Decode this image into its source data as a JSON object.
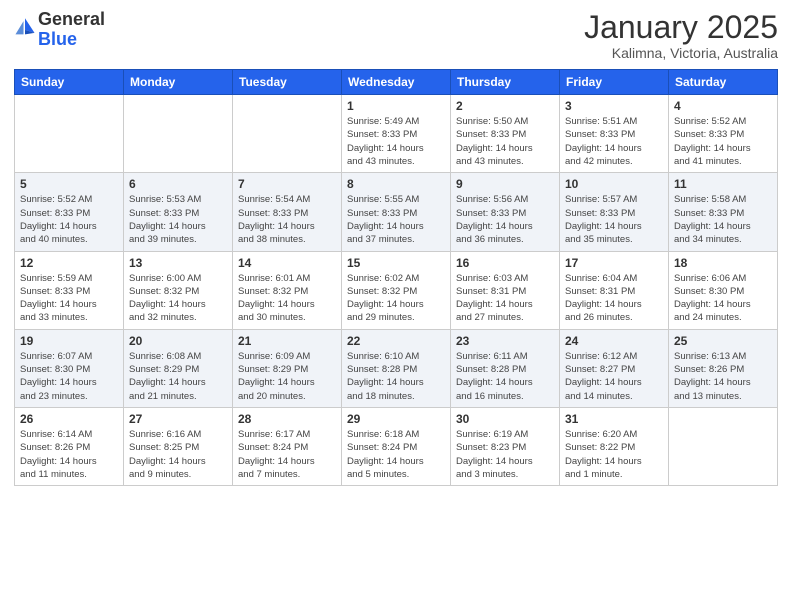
{
  "header": {
    "logo_general": "General",
    "logo_blue": "Blue",
    "month_title": "January 2025",
    "location": "Kalimna, Victoria, Australia"
  },
  "weekdays": [
    "Sunday",
    "Monday",
    "Tuesday",
    "Wednesday",
    "Thursday",
    "Friday",
    "Saturday"
  ],
  "weeks": [
    [
      {
        "num": "",
        "info": ""
      },
      {
        "num": "",
        "info": ""
      },
      {
        "num": "",
        "info": ""
      },
      {
        "num": "1",
        "info": "Sunrise: 5:49 AM\nSunset: 8:33 PM\nDaylight: 14 hours\nand 43 minutes."
      },
      {
        "num": "2",
        "info": "Sunrise: 5:50 AM\nSunset: 8:33 PM\nDaylight: 14 hours\nand 43 minutes."
      },
      {
        "num": "3",
        "info": "Sunrise: 5:51 AM\nSunset: 8:33 PM\nDaylight: 14 hours\nand 42 minutes."
      },
      {
        "num": "4",
        "info": "Sunrise: 5:52 AM\nSunset: 8:33 PM\nDaylight: 14 hours\nand 41 minutes."
      }
    ],
    [
      {
        "num": "5",
        "info": "Sunrise: 5:52 AM\nSunset: 8:33 PM\nDaylight: 14 hours\nand 40 minutes."
      },
      {
        "num": "6",
        "info": "Sunrise: 5:53 AM\nSunset: 8:33 PM\nDaylight: 14 hours\nand 39 minutes."
      },
      {
        "num": "7",
        "info": "Sunrise: 5:54 AM\nSunset: 8:33 PM\nDaylight: 14 hours\nand 38 minutes."
      },
      {
        "num": "8",
        "info": "Sunrise: 5:55 AM\nSunset: 8:33 PM\nDaylight: 14 hours\nand 37 minutes."
      },
      {
        "num": "9",
        "info": "Sunrise: 5:56 AM\nSunset: 8:33 PM\nDaylight: 14 hours\nand 36 minutes."
      },
      {
        "num": "10",
        "info": "Sunrise: 5:57 AM\nSunset: 8:33 PM\nDaylight: 14 hours\nand 35 minutes."
      },
      {
        "num": "11",
        "info": "Sunrise: 5:58 AM\nSunset: 8:33 PM\nDaylight: 14 hours\nand 34 minutes."
      }
    ],
    [
      {
        "num": "12",
        "info": "Sunrise: 5:59 AM\nSunset: 8:33 PM\nDaylight: 14 hours\nand 33 minutes."
      },
      {
        "num": "13",
        "info": "Sunrise: 6:00 AM\nSunset: 8:32 PM\nDaylight: 14 hours\nand 32 minutes."
      },
      {
        "num": "14",
        "info": "Sunrise: 6:01 AM\nSunset: 8:32 PM\nDaylight: 14 hours\nand 30 minutes."
      },
      {
        "num": "15",
        "info": "Sunrise: 6:02 AM\nSunset: 8:32 PM\nDaylight: 14 hours\nand 29 minutes."
      },
      {
        "num": "16",
        "info": "Sunrise: 6:03 AM\nSunset: 8:31 PM\nDaylight: 14 hours\nand 27 minutes."
      },
      {
        "num": "17",
        "info": "Sunrise: 6:04 AM\nSunset: 8:31 PM\nDaylight: 14 hours\nand 26 minutes."
      },
      {
        "num": "18",
        "info": "Sunrise: 6:06 AM\nSunset: 8:30 PM\nDaylight: 14 hours\nand 24 minutes."
      }
    ],
    [
      {
        "num": "19",
        "info": "Sunrise: 6:07 AM\nSunset: 8:30 PM\nDaylight: 14 hours\nand 23 minutes."
      },
      {
        "num": "20",
        "info": "Sunrise: 6:08 AM\nSunset: 8:29 PM\nDaylight: 14 hours\nand 21 minutes."
      },
      {
        "num": "21",
        "info": "Sunrise: 6:09 AM\nSunset: 8:29 PM\nDaylight: 14 hours\nand 20 minutes."
      },
      {
        "num": "22",
        "info": "Sunrise: 6:10 AM\nSunset: 8:28 PM\nDaylight: 14 hours\nand 18 minutes."
      },
      {
        "num": "23",
        "info": "Sunrise: 6:11 AM\nSunset: 8:28 PM\nDaylight: 14 hours\nand 16 minutes."
      },
      {
        "num": "24",
        "info": "Sunrise: 6:12 AM\nSunset: 8:27 PM\nDaylight: 14 hours\nand 14 minutes."
      },
      {
        "num": "25",
        "info": "Sunrise: 6:13 AM\nSunset: 8:26 PM\nDaylight: 14 hours\nand 13 minutes."
      }
    ],
    [
      {
        "num": "26",
        "info": "Sunrise: 6:14 AM\nSunset: 8:26 PM\nDaylight: 14 hours\nand 11 minutes."
      },
      {
        "num": "27",
        "info": "Sunrise: 6:16 AM\nSunset: 8:25 PM\nDaylight: 14 hours\nand 9 minutes."
      },
      {
        "num": "28",
        "info": "Sunrise: 6:17 AM\nSunset: 8:24 PM\nDaylight: 14 hours\nand 7 minutes."
      },
      {
        "num": "29",
        "info": "Sunrise: 6:18 AM\nSunset: 8:24 PM\nDaylight: 14 hours\nand 5 minutes."
      },
      {
        "num": "30",
        "info": "Sunrise: 6:19 AM\nSunset: 8:23 PM\nDaylight: 14 hours\nand 3 minutes."
      },
      {
        "num": "31",
        "info": "Sunrise: 6:20 AM\nSunset: 8:22 PM\nDaylight: 14 hours\nand 1 minute."
      },
      {
        "num": "",
        "info": ""
      }
    ]
  ]
}
